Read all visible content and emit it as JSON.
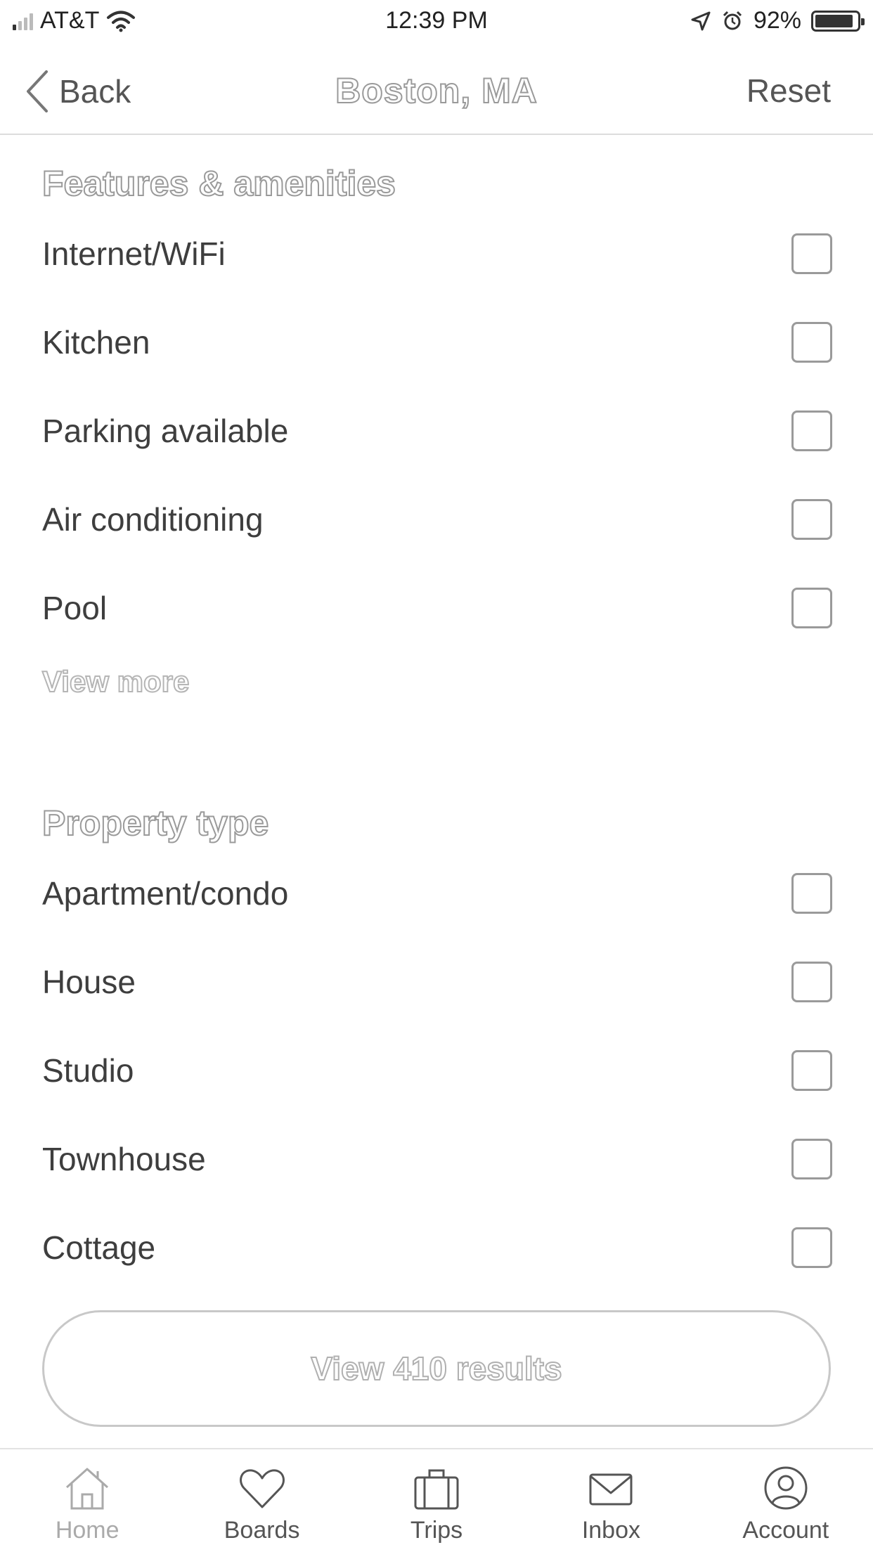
{
  "status_bar": {
    "carrier": "AT&T",
    "time": "12:39 PM",
    "battery": "92%",
    "battery_level": 0.92
  },
  "nav": {
    "back_label": "Back",
    "title": "Boston,  MA",
    "reset_label": "Reset"
  },
  "features": {
    "title": "Features & amenities",
    "options": [
      {
        "label": "Internet/WiFi",
        "checked": false
      },
      {
        "label": "Kitchen",
        "checked": false
      },
      {
        "label": "Parking available",
        "checked": false
      },
      {
        "label": "Air conditioning",
        "checked": false
      },
      {
        "label": "Pool",
        "checked": false
      }
    ],
    "view_more": "View more"
  },
  "property_type": {
    "title": "Property type",
    "options": [
      {
        "label": "Apartment/condo",
        "checked": false
      },
      {
        "label": "House",
        "checked": false
      },
      {
        "label": "Studio",
        "checked": false
      },
      {
        "label": "Townhouse",
        "checked": false
      },
      {
        "label": "Cottage",
        "checked": false
      }
    ]
  },
  "results_button": "View 410 results",
  "tabs": [
    {
      "label": "Home",
      "icon": "home-icon",
      "active": true
    },
    {
      "label": "Boards",
      "icon": "heart-icon",
      "active": false
    },
    {
      "label": "Trips",
      "icon": "suitcase-icon",
      "active": false
    },
    {
      "label": "Inbox",
      "icon": "envelope-icon",
      "active": false
    },
    {
      "label": "Account",
      "icon": "user-circle-icon",
      "active": false
    }
  ]
}
